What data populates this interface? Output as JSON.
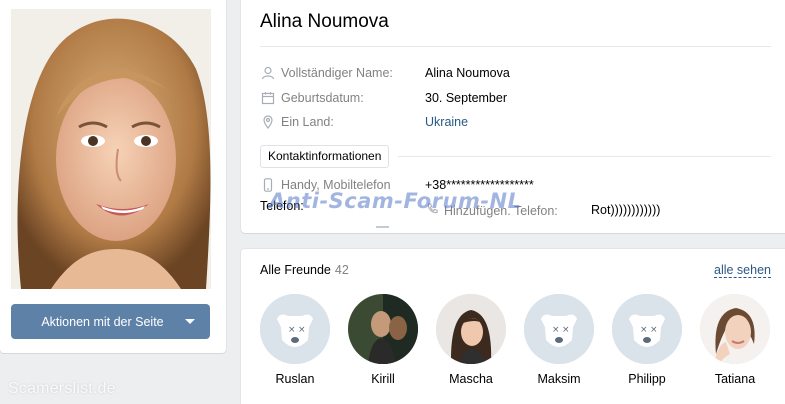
{
  "profile": {
    "name": "Alina Noumova",
    "actions_button": "Aktionen mit der Seite",
    "fields": [
      {
        "label": "Vollständiger Name:",
        "value": "Alina Noumova",
        "icon": "person-icon"
      },
      {
        "label": "Geburtsdatum:",
        "value": "30. September",
        "icon": "calendar-icon"
      },
      {
        "label": "Ein Land:",
        "value": "Ukraine",
        "icon": "location-icon"
      }
    ],
    "contact_button": "Kontaktinformationen",
    "mobile": {
      "label": "Handy, Mobiltelefon",
      "value": "+38******************"
    },
    "telefon_label": "Telefon:",
    "extra_phone": {
      "label": "Hinzufügen. Telefon:",
      "value": "Rot))))))))))))"
    }
  },
  "watermarks": {
    "center": "Anti-Scam-Forum-NL",
    "footer": "Scamerslist.de"
  },
  "friends": {
    "title": "Alle Freunde",
    "count": "42",
    "see_all": "alle sehen",
    "list": [
      {
        "name": "Ruslan",
        "photo": "deactivated"
      },
      {
        "name": "Kirill",
        "photo": "photo"
      },
      {
        "name": "Mascha",
        "photo": "photo"
      },
      {
        "name": "Maksim",
        "photo": "deactivated"
      },
      {
        "name": "Philipp",
        "photo": "deactivated"
      },
      {
        "name": "Tatiana",
        "photo": "photo"
      }
    ]
  },
  "colors": {
    "accent": "#5e81a8",
    "link": "#2a5885",
    "muted": "#828282",
    "background": "#edeef0"
  }
}
